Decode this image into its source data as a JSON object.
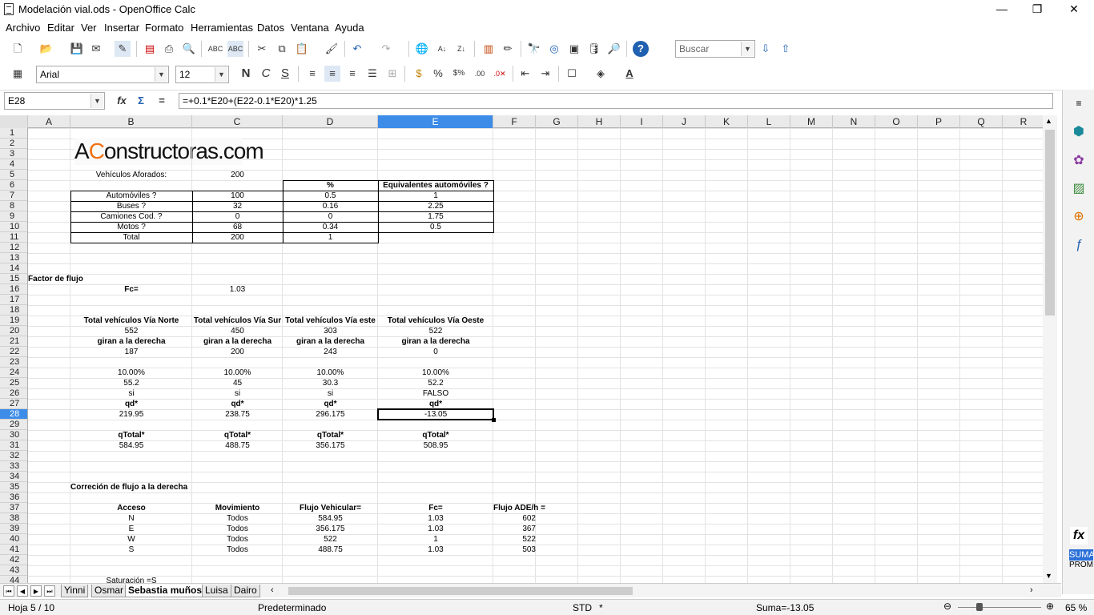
{
  "window": {
    "title": "Modelación vial.ods - OpenOffice Calc",
    "minimize_glyph": "—",
    "restore_glyph": "❐",
    "close_glyph": "✕"
  },
  "menu": [
    "Archivo",
    "Editar",
    "Ver",
    "Insertar",
    "Formato",
    "Herramientas",
    "Datos",
    "Ventana",
    "Ayuda"
  ],
  "toolbar": {
    "search_placeholder": "Buscar",
    "font_name": "Arial",
    "font_size": "12",
    "bold": "N",
    "italic": "C",
    "underline": "S"
  },
  "formula_bar": {
    "cell_ref": "E28",
    "formula": "=+0.1*E20+(E22-0.1*E20)*1.25",
    "fx": "fx",
    "sum": "Σ",
    "equals": "="
  },
  "columns": [
    "A",
    "B",
    "C",
    "D",
    "E",
    "F",
    "G",
    "H",
    "I",
    "J",
    "K",
    "L",
    "M",
    "N",
    "O",
    "P",
    "Q",
    "R"
  ],
  "selected_column": "E",
  "selected_row": 28,
  "logo": {
    "prefix": "A",
    "highlight": "C",
    "rest": "onstructoras.com"
  },
  "cells": [
    {
      "r": 5,
      "c": "B",
      "v": "Vehículos Aforados:",
      "a": "ct"
    },
    {
      "r": 5,
      "c": "C",
      "v": "200",
      "a": "ct"
    },
    {
      "r": 6,
      "c": "D",
      "v": "%",
      "a": "ct",
      "b": true
    },
    {
      "r": 6,
      "c": "E",
      "v": "Equivalentes automóviles ?",
      "a": "ct",
      "b": true
    },
    {
      "r": 7,
      "c": "B",
      "v": "Automóviles ?",
      "a": "ct"
    },
    {
      "r": 7,
      "c": "C",
      "v": "100",
      "a": "ct"
    },
    {
      "r": 7,
      "c": "D",
      "v": "0.5",
      "a": "ct"
    },
    {
      "r": 7,
      "c": "E",
      "v": "1",
      "a": "ct"
    },
    {
      "r": 8,
      "c": "B",
      "v": "Buses ?",
      "a": "ct"
    },
    {
      "r": 8,
      "c": "C",
      "v": "32",
      "a": "ct"
    },
    {
      "r": 8,
      "c": "D",
      "v": "0.16",
      "a": "ct"
    },
    {
      "r": 8,
      "c": "E",
      "v": "2.25",
      "a": "ct"
    },
    {
      "r": 9,
      "c": "B",
      "v": "Camiones Cod. ?",
      "a": "ct"
    },
    {
      "r": 9,
      "c": "C",
      "v": "0",
      "a": "ct"
    },
    {
      "r": 9,
      "c": "D",
      "v": "0",
      "a": "ct"
    },
    {
      "r": 9,
      "c": "E",
      "v": "1.75",
      "a": "ct"
    },
    {
      "r": 10,
      "c": "B",
      "v": "Motos ?",
      "a": "ct"
    },
    {
      "r": 10,
      "c": "C",
      "v": "68",
      "a": "ct"
    },
    {
      "r": 10,
      "c": "D",
      "v": "0.34",
      "a": "ct"
    },
    {
      "r": 10,
      "c": "E",
      "v": "0.5",
      "a": "ct"
    },
    {
      "r": 11,
      "c": "B",
      "v": "Total",
      "a": "ct"
    },
    {
      "r": 11,
      "c": "C",
      "v": "200",
      "a": "ct"
    },
    {
      "r": 11,
      "c": "D",
      "v": "1",
      "a": "ct"
    },
    {
      "r": 15,
      "c": "A",
      "v": "Factor de flujo",
      "a": "l",
      "b": true
    },
    {
      "r": 16,
      "c": "B",
      "v": "Fc=",
      "a": "ct",
      "b": true
    },
    {
      "r": 16,
      "c": "C",
      "v": "1.03",
      "a": "ct"
    },
    {
      "r": 19,
      "c": "B",
      "v": "Total vehículos Vía Norte",
      "a": "ct",
      "b": true
    },
    {
      "r": 19,
      "c": "C",
      "v": "Total vehículos Vía Sur",
      "a": "ct",
      "b": true
    },
    {
      "r": 19,
      "c": "D",
      "v": "Total vehículos Vía este",
      "a": "ct",
      "b": true
    },
    {
      "r": 19,
      "c": "E",
      "v": "Total vehículos Vía Oeste",
      "a": "ct",
      "b": true
    },
    {
      "r": 20,
      "c": "B",
      "v": "552",
      "a": "ct"
    },
    {
      "r": 20,
      "c": "C",
      "v": "450",
      "a": "ct"
    },
    {
      "r": 20,
      "c": "D",
      "v": "303",
      "a": "ct"
    },
    {
      "r": 20,
      "c": "E",
      "v": "522",
      "a": "ct"
    },
    {
      "r": 21,
      "c": "B",
      "v": "giran a la derecha",
      "a": "ct",
      "b": true
    },
    {
      "r": 21,
      "c": "C",
      "v": "giran a la derecha",
      "a": "ct",
      "b": true
    },
    {
      "r": 21,
      "c": "D",
      "v": "giran a la derecha",
      "a": "ct",
      "b": true
    },
    {
      "r": 21,
      "c": "E",
      "v": "giran a la derecha",
      "a": "ct",
      "b": true
    },
    {
      "r": 22,
      "c": "B",
      "v": "187",
      "a": "ct"
    },
    {
      "r": 22,
      "c": "C",
      "v": "200",
      "a": "ct"
    },
    {
      "r": 22,
      "c": "D",
      "v": "243",
      "a": "ct"
    },
    {
      "r": 22,
      "c": "E",
      "v": "0",
      "a": "ct"
    },
    {
      "r": 24,
      "c": "B",
      "v": "10.00%",
      "a": "ct"
    },
    {
      "r": 24,
      "c": "C",
      "v": "10.00%",
      "a": "ct"
    },
    {
      "r": 24,
      "c": "D",
      "v": "10.00%",
      "a": "ct"
    },
    {
      "r": 24,
      "c": "E",
      "v": "10.00%",
      "a": "ct"
    },
    {
      "r": 25,
      "c": "B",
      "v": "55.2",
      "a": "ct"
    },
    {
      "r": 25,
      "c": "C",
      "v": "45",
      "a": "ct"
    },
    {
      "r": 25,
      "c": "D",
      "v": "30.3",
      "a": "ct"
    },
    {
      "r": 25,
      "c": "E",
      "v": "52.2",
      "a": "ct"
    },
    {
      "r": 26,
      "c": "B",
      "v": "si",
      "a": "ct"
    },
    {
      "r": 26,
      "c": "C",
      "v": "si",
      "a": "ct"
    },
    {
      "r": 26,
      "c": "D",
      "v": "si",
      "a": "ct"
    },
    {
      "r": 26,
      "c": "E",
      "v": "FALSO",
      "a": "ct"
    },
    {
      "r": 27,
      "c": "B",
      "v": "qd*",
      "a": "ct",
      "b": true
    },
    {
      "r": 27,
      "c": "C",
      "v": "qd*",
      "a": "ct",
      "b": true
    },
    {
      "r": 27,
      "c": "D",
      "v": "qd*",
      "a": "ct",
      "b": true
    },
    {
      "r": 27,
      "c": "E",
      "v": "qd*",
      "a": "ct",
      "b": true
    },
    {
      "r": 28,
      "c": "B",
      "v": "219.95",
      "a": "ct"
    },
    {
      "r": 28,
      "c": "C",
      "v": "238.75",
      "a": "ct"
    },
    {
      "r": 28,
      "c": "D",
      "v": "296.175",
      "a": "ct"
    },
    {
      "r": 28,
      "c": "E",
      "v": "-13.05",
      "a": "ct"
    },
    {
      "r": 30,
      "c": "B",
      "v": "qTotal*",
      "a": "ct",
      "b": true
    },
    {
      "r": 30,
      "c": "C",
      "v": "qTotal*",
      "a": "ct",
      "b": true
    },
    {
      "r": 30,
      "c": "D",
      "v": "qTotal*",
      "a": "ct",
      "b": true
    },
    {
      "r": 30,
      "c": "E",
      "v": "qTotal*",
      "a": "ct",
      "b": true
    },
    {
      "r": 31,
      "c": "B",
      "v": "584.95",
      "a": "ct"
    },
    {
      "r": 31,
      "c": "C",
      "v": "488.75",
      "a": "ct"
    },
    {
      "r": 31,
      "c": "D",
      "v": "356.175",
      "a": "ct"
    },
    {
      "r": 31,
      "c": "E",
      "v": "508.95",
      "a": "ct"
    },
    {
      "r": 35,
      "c": "B",
      "v": "Correción de flujo a la derecha",
      "a": "l",
      "b": true
    },
    {
      "r": 37,
      "c": "B",
      "v": "Acceso",
      "a": "ct",
      "b": true
    },
    {
      "r": 37,
      "c": "C",
      "v": "Movimiento",
      "a": "ct",
      "b": true
    },
    {
      "r": 37,
      "c": "D",
      "v": "Flujo Vehicular=",
      "a": "ct",
      "b": true
    },
    {
      "r": 37,
      "c": "E",
      "v": "Fc=",
      "a": "ct",
      "b": true
    },
    {
      "r": 37,
      "c": "F",
      "v": "Flujo ADE/h =",
      "a": "l",
      "b": true
    },
    {
      "r": 38,
      "c": "B",
      "v": "N",
      "a": "ct"
    },
    {
      "r": 38,
      "c": "C",
      "v": "Todos",
      "a": "ct"
    },
    {
      "r": 38,
      "c": "D",
      "v": "584.95",
      "a": "ct"
    },
    {
      "r": 38,
      "c": "E",
      "v": "1.03",
      "a": "ct"
    },
    {
      "r": 38,
      "c": "F",
      "v": "602",
      "a": "rt"
    },
    {
      "r": 39,
      "c": "B",
      "v": "E",
      "a": "ct"
    },
    {
      "r": 39,
      "c": "C",
      "v": "Todos",
      "a": "ct"
    },
    {
      "r": 39,
      "c": "D",
      "v": "356.175",
      "a": "ct"
    },
    {
      "r": 39,
      "c": "E",
      "v": "1.03",
      "a": "ct"
    },
    {
      "r": 39,
      "c": "F",
      "v": "367",
      "a": "rt"
    },
    {
      "r": 40,
      "c": "B",
      "v": "W",
      "a": "ct"
    },
    {
      "r": 40,
      "c": "C",
      "v": "Todos",
      "a": "ct"
    },
    {
      "r": 40,
      "c": "D",
      "v": "522",
      "a": "ct"
    },
    {
      "r": 40,
      "c": "E",
      "v": "1",
      "a": "ct"
    },
    {
      "r": 40,
      "c": "F",
      "v": "522",
      "a": "rt"
    },
    {
      "r": 41,
      "c": "B",
      "v": "S",
      "a": "ct"
    },
    {
      "r": 41,
      "c": "C",
      "v": "Todos",
      "a": "ct"
    },
    {
      "r": 41,
      "c": "D",
      "v": "488.75",
      "a": "ct"
    },
    {
      "r": 41,
      "c": "E",
      "v": "1.03",
      "a": "ct"
    },
    {
      "r": 41,
      "c": "F",
      "v": "503",
      "a": "rt"
    },
    {
      "r": 44,
      "c": "B",
      "v": "Saturación =S",
      "a": "ct"
    }
  ],
  "sheet_tabs": [
    "Yinni",
    "Osmar",
    "Sebastia muños",
    "Luisa",
    "Dairo"
  ],
  "active_tab": "Sebastia muños",
  "status": {
    "sheet": "Hoja 5 / 10",
    "style": "Predeterminado",
    "mode": "STD",
    "modified": "*",
    "sum": "Suma=-13.05",
    "zoom": "65 %"
  },
  "sidebar": {
    "sum_label": "SUMA",
    "prom_label": "PROM"
  }
}
